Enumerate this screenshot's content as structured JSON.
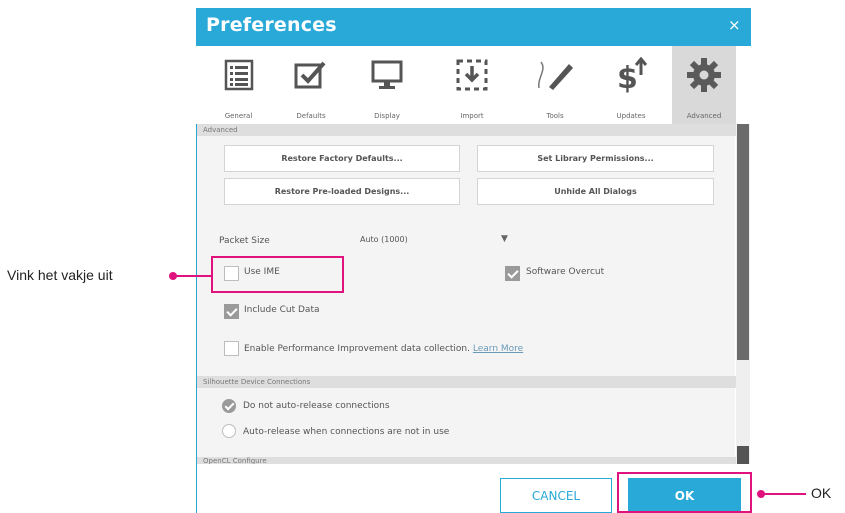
{
  "dialog": {
    "title": "Preferences",
    "close_glyph": "×",
    "colors": {
      "accent": "#29a9d8",
      "highlight": "#e0127e"
    }
  },
  "toolbar": {
    "tabs": [
      {
        "label": "General",
        "icon": "list-icon",
        "active": false
      },
      {
        "label": "Defaults",
        "icon": "checkmark-box-icon",
        "active": false
      },
      {
        "label": "Display",
        "icon": "monitor-icon",
        "active": false
      },
      {
        "label": "Import",
        "icon": "import-icon",
        "active": false
      },
      {
        "label": "Tools",
        "icon": "pen-tool-icon",
        "active": false
      },
      {
        "label": "Updates",
        "icon": "dollar-update-icon",
        "active": false
      },
      {
        "label": "Advanced",
        "icon": "gear-icon",
        "active": true
      }
    ]
  },
  "advanced": {
    "section_title": "Advanced",
    "buttons": {
      "restore_factory": "Restore Factory Defaults...",
      "set_library": "Set Library Permissions...",
      "restore_preloaded": "Restore Pre-loaded Designs...",
      "unhide_dialogs": "Unhide All Dialogs"
    },
    "packet_size": {
      "label": "Packet Size",
      "value": "Auto (1000)"
    },
    "use_ime": {
      "label": "Use IME",
      "checked": false
    },
    "software_overcut": {
      "label": "Software Overcut",
      "checked": true
    },
    "include_cut_data": {
      "label": "Include Cut Data",
      "checked": true
    },
    "performance": {
      "label": "Enable Performance Improvement data collection.",
      "link": "Learn More",
      "checked": false
    }
  },
  "device_connections": {
    "section_title": "Silhouette Device Connections",
    "options": [
      {
        "label": "Do not auto-release connections",
        "selected": true
      },
      {
        "label": "Auto-release when connections are not in use",
        "selected": false
      }
    ]
  },
  "opencl": {
    "section_title": "OpenCL Configure"
  },
  "footer": {
    "cancel_label": "CANCEL",
    "ok_label": "OK"
  },
  "callouts": {
    "left_text": "Vink het vakje uit",
    "right_text": "OK"
  }
}
